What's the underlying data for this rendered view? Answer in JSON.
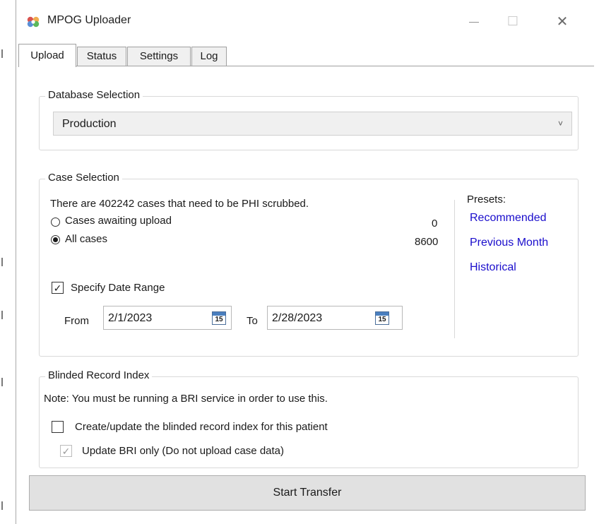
{
  "window": {
    "title": "MPOG Uploader",
    "minimize_glyph": "—",
    "maximize_glyph": "☐",
    "close_glyph": "✕"
  },
  "tabs": [
    {
      "label": "Upload",
      "active": true
    },
    {
      "label": "Status",
      "active": false
    },
    {
      "label": "Settings",
      "active": false
    },
    {
      "label": "Log",
      "active": false
    }
  ],
  "database": {
    "group_title": "Database Selection",
    "selected": "Production",
    "arrow_glyph": "˅"
  },
  "case_selection": {
    "group_title": "Case Selection",
    "summary": "There are 402242 cases that need to be PHI scrubbed.",
    "options": [
      {
        "label": "Cases awaiting upload",
        "count": "0",
        "selected": false
      },
      {
        "label": "All cases",
        "count": "8600",
        "selected": true
      }
    ],
    "presets_label": "Presets:",
    "presets": [
      "Recommended",
      "Previous Month",
      "Historical"
    ],
    "specify_date_range_label": "Specify Date Range",
    "specify_date_range_checked": true,
    "from_label": "From",
    "from_value": "2/1/2023",
    "to_label": "To",
    "to_value": "2/28/2023",
    "calendar_day": "15"
  },
  "bri": {
    "group_title": "Blinded Record Index",
    "note": "Note: You must be running a BRI service in order to use this.",
    "create_update_label": "Create/update the blinded record index for this patient",
    "create_update_checked": false,
    "update_only_label": "Update BRI only (Do not upload case data)",
    "update_only_checked": true,
    "update_only_enabled": false
  },
  "actions": {
    "start_transfer_label": "Start Transfer"
  },
  "colors": {
    "link": "#1a0dcc",
    "button_bg": "#e1e1e1",
    "tab_inactive_bg": "#f0f0f0",
    "group_border": "#d9d9d9"
  }
}
